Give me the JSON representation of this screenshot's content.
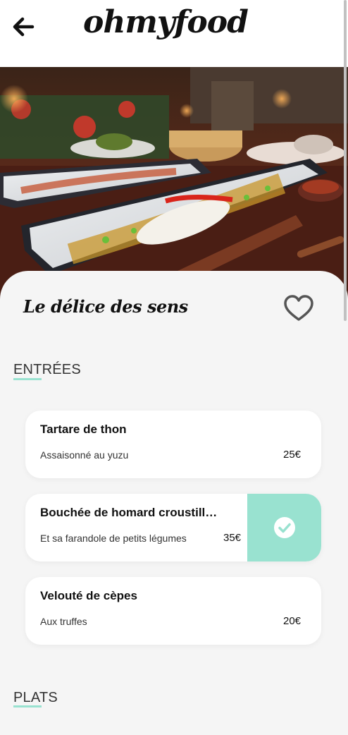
{
  "header": {
    "logo": "ohmyfood",
    "back_icon": "arrow-left-icon"
  },
  "restaurant": {
    "title": "Le délice des sens",
    "favorite_icon": "heart-outline-icon"
  },
  "sections": [
    {
      "title": "ENTRÉES",
      "dishes": [
        {
          "name": "Tartare de thon",
          "description": "Assaisonné au yuzu",
          "price": "25€",
          "selected": false
        },
        {
          "name": "Bouchée de homard croustillante",
          "description": "Et sa farandole de petits légumes",
          "price": "35€",
          "selected": true
        },
        {
          "name": "Velouté de cèpes",
          "description": "Aux truffes",
          "price": "20€",
          "selected": false
        }
      ]
    },
    {
      "title": "PLATS"
    }
  ],
  "colors": {
    "accent": "#99e2d0",
    "panel_bg": "#f5f5f5",
    "text": "#111111"
  }
}
